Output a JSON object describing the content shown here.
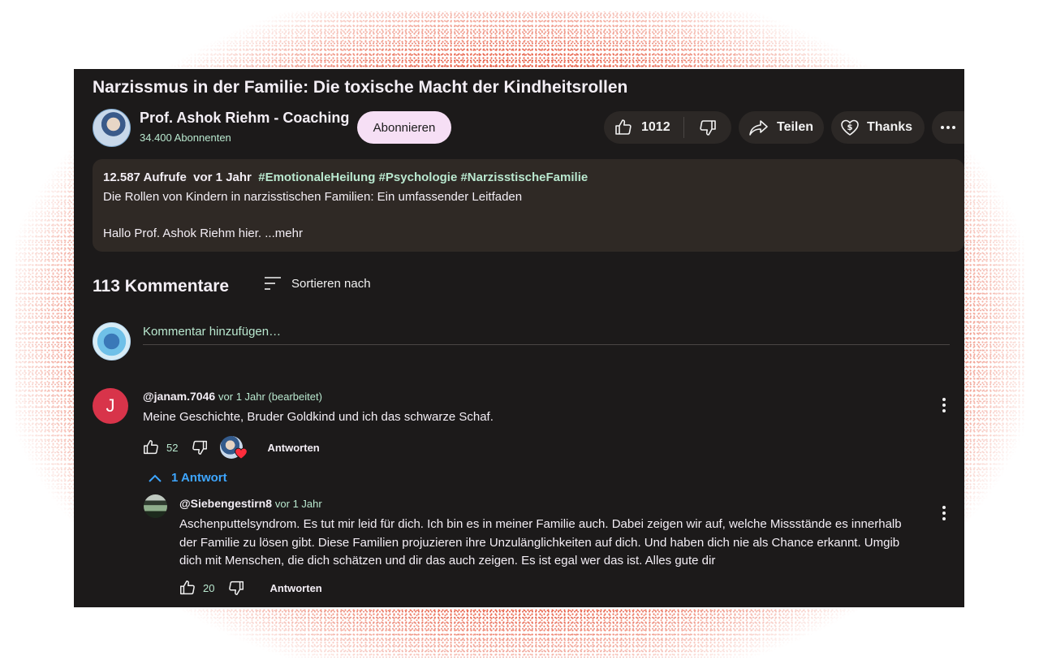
{
  "video": {
    "title": "Narzissmus in der Familie: Die toxische Macht der Kindheitsrollen"
  },
  "channel": {
    "name": "Prof. Ashok Riehm - Coaching",
    "subscribers": "34.400 Abonnenten",
    "subscribe_label": "Abonnieren"
  },
  "actions": {
    "like_count": "1012",
    "share_label": "Teilen",
    "thanks_label": "Thanks"
  },
  "description": {
    "views": "12.587 Aufrufe",
    "age": "vor 1 Jahr",
    "hashtags": "#EmotionaleHeilung #Psychologie #NarzisstischeFamilie",
    "line1": "Die Rollen von Kindern in narzisstischen Familien: Ein umfassender Leitfaden",
    "line2": "Hallo Prof. Ashok Riehm hier.",
    "more_label": "...mehr"
  },
  "comments_section": {
    "count_label": "113 Kommentare",
    "sort_label": "Sortieren nach",
    "add_placeholder": "Kommentar hinzufügen…"
  },
  "comments": [
    {
      "avatar_letter": "J",
      "user": "@janam.7046",
      "time": "vor 1 Jahr (bearbeitet)",
      "text": "Meine Geschichte, Bruder Goldkind und ich das schwarze Schaf.",
      "likes": "52",
      "reply_label": "Antworten",
      "replies_toggle": "1 Antwort"
    }
  ],
  "replies": [
    {
      "user": "@Siebengestirn8",
      "time": "vor 1 Jahr",
      "text": "Aschenputtelsyndrom. Es tut mir leid für dich. Ich bin es in meiner Familie auch. Dabei zeigen wir auf, welche Missstände es innerhalb der Familie zu lösen gibt. Diese Familien projuzieren ihre Unzulänglichkeiten auf dich. Und haben dich nie als Chance erkannt. Umgib dich mit Menschen, die dich schätzen und dir das auch zeigen. Es ist egal wer das ist. Alles gute dir",
      "likes": "20",
      "reply_label": "Antworten"
    }
  ],
  "icons": {
    "like": "thumbs-up-icon",
    "dislike": "thumbs-down-icon",
    "share": "share-arrow-icon",
    "thanks": "heart-dollar-icon",
    "more": "more-horizontal-icon",
    "sort": "sort-lines-icon",
    "kebab": "more-vertical-icon",
    "chevron": "chevron-up-icon",
    "heart": "heart-icon"
  },
  "colors": {
    "page_bg": "#1c1a1a",
    "description_bg": "#2f2925",
    "pill_bg": "#2c2826",
    "subscribe_bg": "#f6dff5",
    "secondary_text": "#b9e8cf",
    "link_blue": "#3ea6ff",
    "avatar_red": "#d8344a",
    "frame_red": "#e63b1e"
  }
}
